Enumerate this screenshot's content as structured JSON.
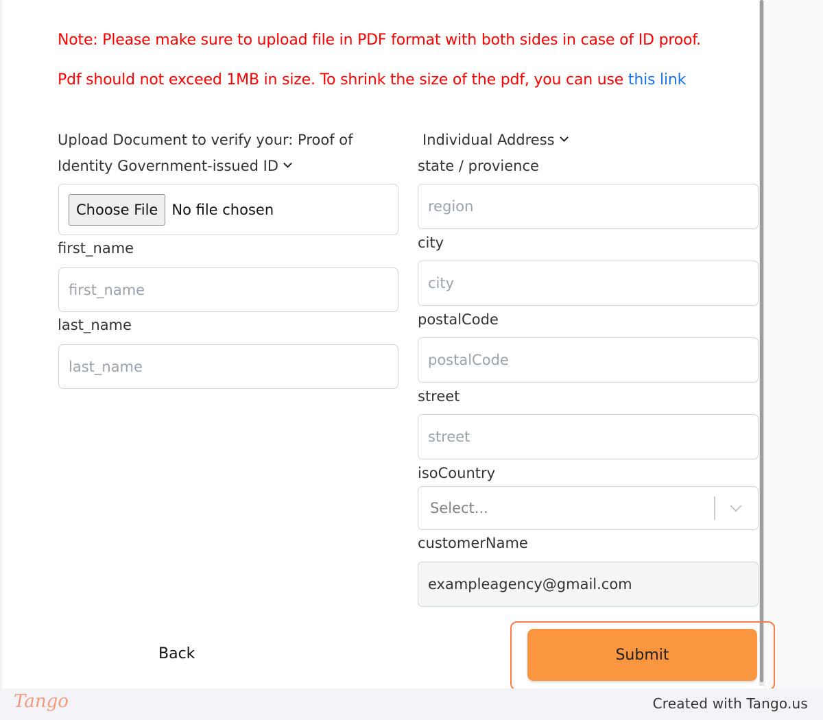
{
  "notes": {
    "format_note": "Note: Please make sure to upload file in PDF format with both sides in case of ID proof.",
    "size_note": "Pdf should not exceed 1MB in size. To shrink the size of the pdf, you can use ",
    "size_note_link": "this link"
  },
  "left_column": {
    "document_label_line1": "Upload Document to verify your: Proof of",
    "document_label_line2": "Identity Government-issued ID",
    "file_input": {
      "button_label": "Choose File",
      "status": "No file chosen"
    },
    "first_name": {
      "label": "first_name",
      "placeholder": "first_name"
    },
    "last_name": {
      "label": "last_name",
      "placeholder": "last_name"
    }
  },
  "right_column": {
    "address_type": "Individual Address",
    "state": {
      "label": "state / provience",
      "placeholder": "region"
    },
    "city": {
      "label": "city",
      "placeholder": "city"
    },
    "postal_code": {
      "label": "postalCode",
      "placeholder": "postalCode"
    },
    "street": {
      "label": "street",
      "placeholder": "street"
    },
    "iso_country": {
      "label": "isoCountry",
      "placeholder": "Select..."
    },
    "customer_name": {
      "label": "customerName",
      "value": "exampleagency@gmail.com"
    }
  },
  "actions": {
    "back_label": "Back",
    "submit_label": "Submit"
  },
  "footer": {
    "logo_text": "Tango",
    "created_with": "Created with Tango.us"
  },
  "colors": {
    "note_red": "#ff0000",
    "link_blue": "#1a73e8",
    "submit_orange": "#fb9640",
    "highlight_orange": "#ff7a45"
  }
}
